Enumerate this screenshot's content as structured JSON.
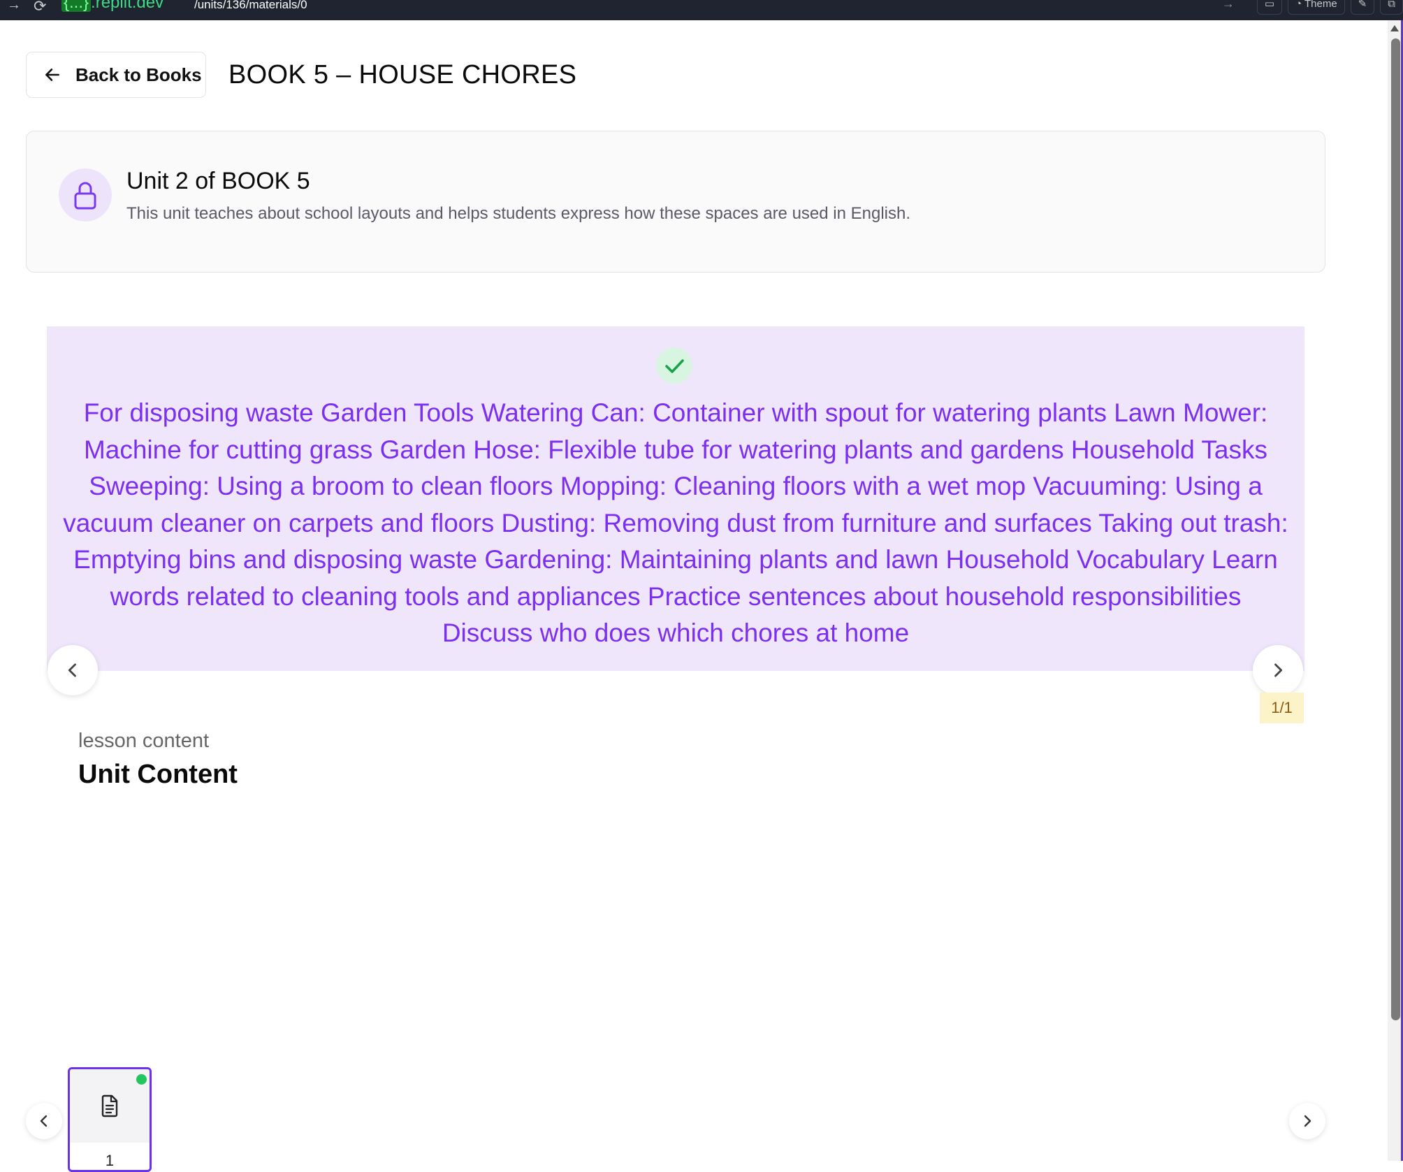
{
  "browser": {
    "domain_brace": "{...}",
    "domain": ".replit.dev",
    "path": "/units/136/materials/0",
    "theme_label": "Theme"
  },
  "header": {
    "back_label": "Back to Books",
    "title": "BOOK 5 – HOUSE CHORES"
  },
  "unit_card": {
    "title": "Unit 2 of BOOK 5",
    "description": "This unit teaches about school layouts and helps students express how these spaces are used in English."
  },
  "slide": {
    "text": "For disposing waste Garden Tools Watering Can: Container with spout for watering plants Lawn Mower: Machine for cutting grass Garden Hose: Flexible tube for watering plants and gardens Household Tasks Sweeping: Using a broom to clean floors Mopping: Cleaning floors with a wet mop Vacuuming: Using a vacuum cleaner on carpets and floors Dusting: Removing dust from furniture and surfaces Taking out trash: Emptying bins and disposing waste Gardening: Maintaining plants and lawn Household Vocabulary Learn words related to cleaning tools and appliances Practice sentences about household responsibilities Discuss who does which chores at home",
    "counter": "1/1"
  },
  "lesson": {
    "label": "lesson content",
    "title": "Unit Content"
  },
  "thumbnails": [
    {
      "number": "1",
      "icon": "document-icon",
      "active": true
    }
  ],
  "colors": {
    "accent": "#6d32e8",
    "slide_bg": "#efe6fc",
    "slide_text": "#7b2ff0",
    "success": "#22c55e"
  }
}
